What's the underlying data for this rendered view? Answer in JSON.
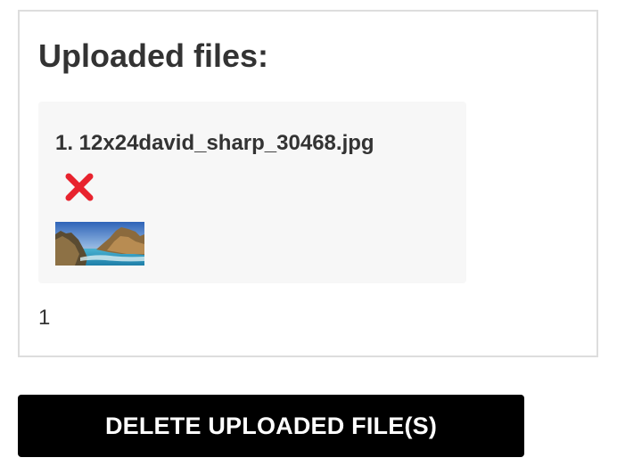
{
  "uploaded_section": {
    "title": "Uploaded files:",
    "files": [
      {
        "name": "1. 12x24david_sharp_30468.jpg",
        "delete_icon": "close-icon",
        "delete_icon_color": "#e8232e",
        "thumbnail": "coastal-landscape-thumbnail"
      }
    ],
    "count": "1"
  },
  "actions": {
    "delete_all_label": "DELETE UPLOADED FILE(S)"
  },
  "colors": {
    "panel_border": "#dddddd",
    "card_background": "#f7f7f7",
    "button_background": "#000000",
    "button_text": "#ffffff",
    "text": "#333333"
  }
}
